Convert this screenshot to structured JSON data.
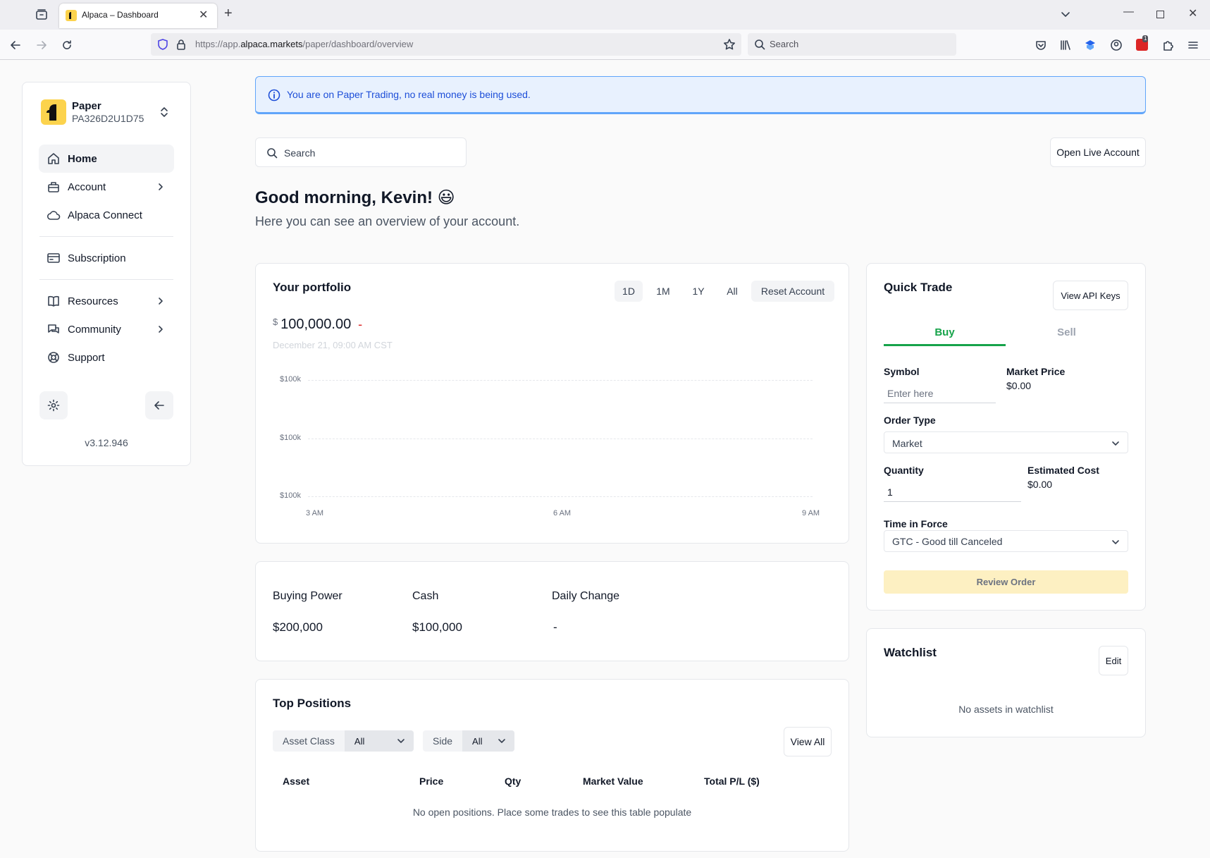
{
  "browser": {
    "tab_title": "Alpaca – Dashboard",
    "url_prefix": "https://app.",
    "url_domain": "alpaca.markets",
    "url_path": "/paper/dashboard/overview",
    "search_placeholder": "Search",
    "extension_badge": "1"
  },
  "sidebar": {
    "account_type": "Paper",
    "account_id": "PA326D2U1D75",
    "items": [
      {
        "label": "Home",
        "icon": "home-icon",
        "active": true
      },
      {
        "label": "Account",
        "icon": "briefcase-icon",
        "chevron": true
      },
      {
        "label": "Alpaca Connect",
        "icon": "cloud-icon"
      },
      {
        "label": "Subscription",
        "icon": "credit-card-icon"
      },
      {
        "label": "Resources",
        "icon": "book-icon",
        "chevron": true
      },
      {
        "label": "Community",
        "icon": "chat-icon",
        "chevron": true
      },
      {
        "label": "Support",
        "icon": "lifebuoy-icon"
      }
    ],
    "version": "v3.12.946"
  },
  "banner": {
    "text": "You are on Paper Trading, no real money is being used."
  },
  "header": {
    "search_placeholder": "Search",
    "open_live_label": "Open Live Account",
    "greeting": "Good morning, Kevin!",
    "emoji": "😃",
    "subtitle": "Here you can see an overview of your account."
  },
  "portfolio": {
    "title": "Your portfolio",
    "ranges": [
      "1D",
      "1M",
      "1Y",
      "All"
    ],
    "active_range": "1D",
    "reset_label": "Reset Account",
    "currency": "$",
    "value": "100,000.00",
    "change": "-",
    "timestamp": "December 21, 09:00 AM CST"
  },
  "chart_data": {
    "type": "line",
    "title": "",
    "xlabel": "",
    "ylabel": "",
    "y_tick_labels": [
      "$100k",
      "$100k",
      "$100k"
    ],
    "x_tick_labels": [
      "3 AM",
      "6 AM",
      "9 AM"
    ],
    "series": [],
    "grid": true
  },
  "balances": {
    "items": [
      {
        "label": "Buying Power",
        "value": "$200,000"
      },
      {
        "label": "Cash",
        "value": "$100,000"
      },
      {
        "label": "Daily Change",
        "value": "-"
      }
    ]
  },
  "positions": {
    "title": "Top Positions",
    "asset_class_label": "Asset Class",
    "asset_class_value": "All",
    "side_label": "Side",
    "side_value": "All",
    "view_all_label": "View All",
    "columns": [
      "Asset",
      "Price",
      "Qty",
      "Market Value",
      "Total P/L ($)"
    ],
    "empty_text": "No open positions. Place some trades to see this table populate"
  },
  "quick_trade": {
    "title": "Quick Trade",
    "api_keys_label": "View API Keys",
    "tabs": [
      "Buy",
      "Sell"
    ],
    "active_tab": "Buy",
    "symbol_label": "Symbol",
    "symbol_placeholder": "Enter here",
    "market_price_label": "Market Price",
    "market_price_value": "$0.00",
    "order_type_label": "Order Type",
    "order_type_value": "Market",
    "quantity_label": "Quantity",
    "quantity_value": "1",
    "estimated_cost_label": "Estimated Cost",
    "estimated_cost_value": "$0.00",
    "tif_label": "Time in Force",
    "tif_value": "GTC - Good till Canceled",
    "review_label": "Review Order"
  },
  "watchlist": {
    "title": "Watchlist",
    "edit_label": "Edit",
    "empty_text": "No assets in watchlist"
  },
  "colors": {
    "accent_green": "#16a34a",
    "banner_bg": "#e8f1fe",
    "banner_border": "#60a5fa",
    "banner_text": "#1d4ed8",
    "logo_yellow": "#fcd34d",
    "review_bg": "#fdf0c2",
    "negative_red": "#dc2626"
  }
}
